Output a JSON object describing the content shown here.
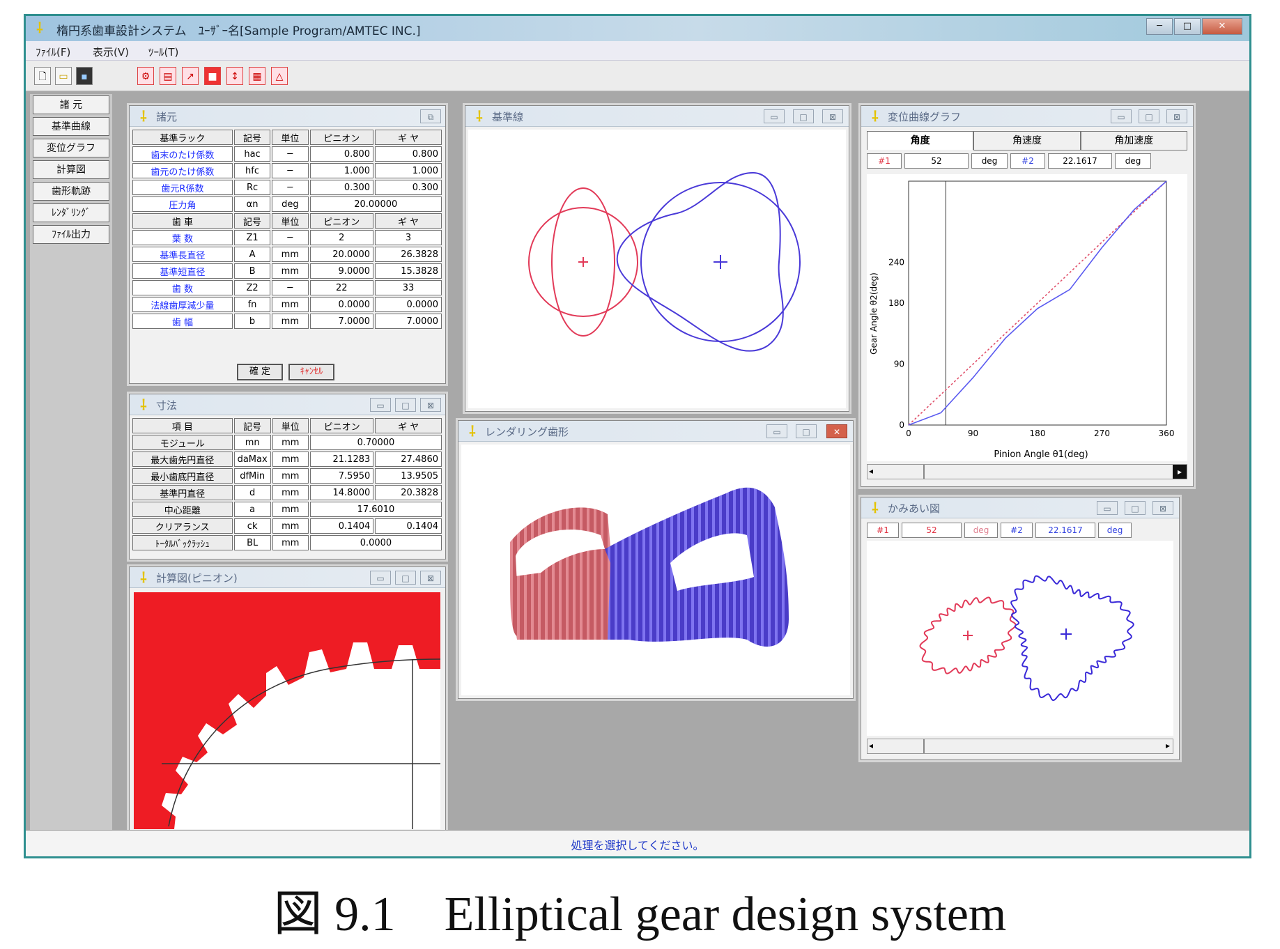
{
  "window": {
    "title": "楕円系歯車設計システム　ﾕｰｻﾞｰ名[Sample Program/AMTEC INC.]",
    "min": "─",
    "max": "□",
    "close": "✕"
  },
  "menu": [
    "ﾌｧｲﾙ(F)",
    "表示(V)",
    "ﾂｰﾙ(T)"
  ],
  "toolbar_icons": [
    "new-file-icon",
    "open-folder-icon",
    "save-disk-icon",
    "gear-tool-icon",
    "table-tool-icon",
    "graph-tool-icon",
    "color-tool-icon",
    "sort-tool-icon",
    "image-tool-icon",
    "print-tool-icon"
  ],
  "sidebar": [
    "諸 元",
    "基準曲線",
    "変位グラフ",
    "計算図",
    "歯形軌跡",
    "ﾚﾝﾀﾞﾘﾝｸﾞ",
    "ﾌｧｲﾙ出力"
  ],
  "spec": {
    "title": "諸元",
    "header": [
      "基準ラック",
      "記号",
      "単位",
      "ピニオン",
      "ギ ヤ"
    ],
    "rows": [
      [
        "歯末のたけ係数",
        "hac",
        "─",
        "0.800",
        "0.800"
      ],
      [
        "歯元のたけ係数",
        "hfc",
        "─",
        "1.000",
        "1.000"
      ],
      [
        "歯元R係数",
        "Rc",
        "─",
        "0.300",
        "0.300"
      ],
      [
        "圧力角",
        "αn",
        "deg",
        "20.00000"
      ]
    ],
    "header2": [
      "歯 車",
      "記号",
      "単位",
      "ピニオン",
      "ギ ヤ"
    ],
    "rows2": [
      [
        "葉 数",
        "Z1",
        "─",
        "2",
        "3"
      ],
      [
        "基準長直径",
        "A",
        "mm",
        "20.0000",
        "26.3828"
      ],
      [
        "基準短直径",
        "B",
        "mm",
        "9.0000",
        "15.3828"
      ],
      [
        "歯 数",
        "Z2",
        "─",
        "22",
        "33"
      ],
      [
        "法線歯厚減少量",
        "fn",
        "mm",
        "0.0000",
        "0.0000"
      ],
      [
        "歯 幅",
        "b",
        "mm",
        "7.0000",
        "7.0000"
      ]
    ],
    "btn_ok": "確 定",
    "btn_cancel": "ｷｬﾝｾﾙ"
  },
  "dims": {
    "title": "寸法",
    "header": [
      "項 目",
      "記号",
      "単位",
      "ピニオン",
      "ギ ヤ"
    ],
    "rows": [
      [
        "モジュール",
        "mn",
        "mm",
        "0.70000"
      ],
      [
        "最大歯先円直径",
        "daMax",
        "mm",
        "21.1283",
        "27.4860"
      ],
      [
        "最小歯底円直径",
        "dfMin",
        "mm",
        "7.5950",
        "13.9505"
      ],
      [
        "基準円直径",
        "d",
        "mm",
        "14.8000",
        "20.3828"
      ],
      [
        "中心距離",
        "a",
        "mm",
        "17.6010"
      ],
      [
        "クリアランス",
        "ck",
        "mm",
        "0.1404",
        "0.1404"
      ],
      [
        "ﾄｰﾀﾙﾊﾞｯｸﾗｯｼｭ",
        "BL",
        "mm",
        "0.0000"
      ]
    ]
  },
  "base": {
    "title": "基準線"
  },
  "render": {
    "title": "レンダリング歯形"
  },
  "calcfig": {
    "title": "計算図(ピニオン)"
  },
  "disp": {
    "title": "変位曲線グラフ",
    "tabs": [
      "角度",
      "角速度",
      "角加速度"
    ],
    "fields": [
      "#1",
      "52",
      "deg",
      "#2",
      "22.1617",
      "deg"
    ],
    "xlabel": "Pinion Angle θ1(deg)",
    "ylabel": "Gear Angle θ2(deg)",
    "xticks": [
      "0",
      "90",
      "180",
      "270",
      "360"
    ],
    "yticks": [
      "0",
      "90",
      "180",
      "240"
    ]
  },
  "mesh": {
    "title": "かみあい図",
    "fields": [
      "#1",
      "52",
      "deg",
      "#2",
      "22.1617",
      "deg"
    ]
  },
  "status": "処理を選択してください。",
  "chart_data": {
    "type": "line",
    "x": [
      0,
      45,
      90,
      135,
      180,
      225,
      270,
      315,
      360
    ],
    "series": [
      {
        "values": [
          0,
          18,
          70,
          128,
          172,
          200,
          262,
          318,
          360
        ]
      },
      {
        "values": [
          0,
          45,
          90,
          135,
          180,
          225,
          270,
          315,
          360
        ]
      }
    ],
    "xlim": [
      0,
      360
    ],
    "ylim": [
      0,
      360
    ],
    "cursor_x": 52,
    "colors": {
      "curve": "#5a5af0",
      "reference": "#e0506a"
    }
  },
  "caption": "図 9.1　Elliptical gear design system"
}
